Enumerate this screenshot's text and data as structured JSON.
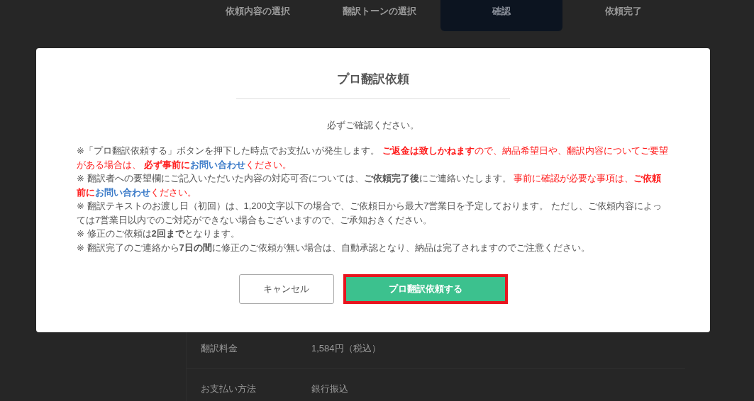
{
  "steps": [
    {
      "label": "依頼内容の選択",
      "selected": false
    },
    {
      "label": "翻訳トーンの選択",
      "selected": false
    },
    {
      "label": "確認",
      "selected": true
    },
    {
      "label": "依頼完了",
      "selected": false
    }
  ],
  "details": [
    {
      "label": "翻訳料金",
      "value": "1,584円（税込）"
    },
    {
      "label": "お支払い方法",
      "value": "銀行振込"
    }
  ],
  "modal": {
    "title": "プロ翻訳依頼",
    "subtitle": "必ずご確認ください。",
    "notes": [
      [
        {
          "kind": "plain",
          "text": "※「プロ翻訳依頼する」ボタンを押下した時点でお支払いが発生します。 "
        },
        {
          "kind": "alert-bold",
          "text": "ご返金は致しかねます"
        },
        {
          "kind": "alert",
          "text": "ので、納品希望日や、翻訳内容についてご要望がある場合は、 "
        },
        {
          "kind": "alert-bold",
          "text": "必ず事前に"
        },
        {
          "kind": "link",
          "text": "お問い合わせ"
        },
        {
          "kind": "alert",
          "text": "ください。"
        }
      ],
      [
        {
          "kind": "plain",
          "text": "※ 翻訳者への要望欄にご記入いただいた内容の対応可否については、"
        },
        {
          "kind": "bold",
          "text": "ご依頼完了後"
        },
        {
          "kind": "plain",
          "text": "にご連絡いたします。 "
        },
        {
          "kind": "alert",
          "text": "事前に確認が必要な事項は、"
        },
        {
          "kind": "alert-bold",
          "text": "ご依頼前に"
        },
        {
          "kind": "link",
          "text": "お問い合わせ"
        },
        {
          "kind": "alert",
          "text": "ください。"
        }
      ],
      [
        {
          "kind": "plain",
          "text": "※ 翻訳テキストのお渡し日（初回）は、1,200文字以下の場合で、ご依頼日から最大7営業日を予定しております。 ただし、ご依頼内容によっては7営業日以内でのご対応ができない場合もございますので、ご承知おきください。"
        }
      ],
      [
        {
          "kind": "plain",
          "text": "※ 修正のご依頼は"
        },
        {
          "kind": "bold",
          "text": "2回まで"
        },
        {
          "kind": "plain",
          "text": "となります。"
        }
      ],
      [
        {
          "kind": "plain",
          "text": "※ 翻訳完了のご連絡から"
        },
        {
          "kind": "bold",
          "text": "7日の間"
        },
        {
          "kind": "plain",
          "text": "に修正のご依頼が無い場合は、自動承認となり、納品は完了されますのでご注意ください。"
        }
      ]
    ],
    "buttons": [
      {
        "kind": "secondary",
        "label": "キャンセル",
        "highlighted": false
      },
      {
        "kind": "primary",
        "label": "プロ翻訳依頼する",
        "highlighted": true
      }
    ]
  }
}
